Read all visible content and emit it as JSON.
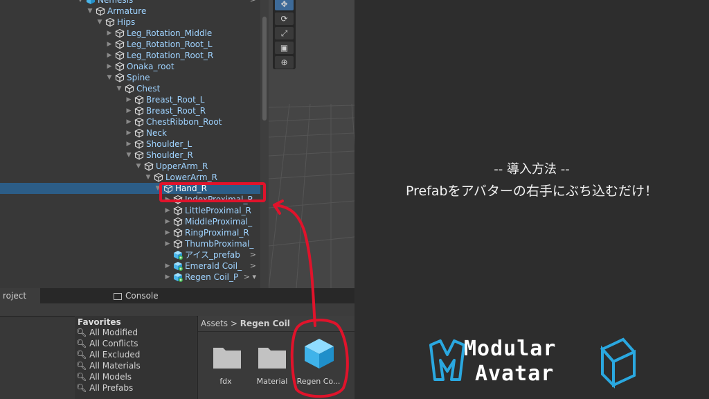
{
  "hierarchy": {
    "rows": [
      {
        "label": "Nemesis",
        "depth": 0,
        "arrow": "▼",
        "icon": "prefab-icon",
        "more": ">"
      },
      {
        "label": "Armature",
        "depth": 1,
        "arrow": "▼",
        "icon": "gameobject-icon"
      },
      {
        "label": "Hips",
        "depth": 2,
        "arrow": "▼",
        "icon": "gameobject-icon"
      },
      {
        "label": "Leg_Rotation_Middle",
        "depth": 3,
        "arrow": "▶",
        "icon": "gameobject-icon"
      },
      {
        "label": "Leg_Rotation_Root_L",
        "depth": 3,
        "arrow": "▶",
        "icon": "gameobject-icon"
      },
      {
        "label": "Leg_Rotation_Root_R",
        "depth": 3,
        "arrow": "▶",
        "icon": "gameobject-icon"
      },
      {
        "label": "Onaka_root",
        "depth": 3,
        "arrow": "▶",
        "icon": "gameobject-icon"
      },
      {
        "label": "Spine",
        "depth": 3,
        "arrow": "▼",
        "icon": "gameobject-icon"
      },
      {
        "label": "Chest",
        "depth": 4,
        "arrow": "▼",
        "icon": "gameobject-icon"
      },
      {
        "label": "Breast_Root_L",
        "depth": 5,
        "arrow": "▶",
        "icon": "gameobject-icon"
      },
      {
        "label": "Breast_Root_R",
        "depth": 5,
        "arrow": "▶",
        "icon": "gameobject-icon"
      },
      {
        "label": "ChestRibbon_Root",
        "depth": 5,
        "arrow": "▶",
        "icon": "gameobject-icon"
      },
      {
        "label": "Neck",
        "depth": 5,
        "arrow": "▶",
        "icon": "gameobject-icon"
      },
      {
        "label": "Shoulder_L",
        "depth": 5,
        "arrow": "▶",
        "icon": "gameobject-icon"
      },
      {
        "label": "Shoulder_R",
        "depth": 5,
        "arrow": "▼",
        "icon": "gameobject-icon"
      },
      {
        "label": "UpperArm_R",
        "depth": 6,
        "arrow": "▼",
        "icon": "gameobject-icon"
      },
      {
        "label": "LowerArm_R",
        "depth": 7,
        "arrow": "▼",
        "icon": "gameobject-icon"
      },
      {
        "label": "Hand_R",
        "depth": 8,
        "arrow": "▼",
        "icon": "gameobject-icon",
        "selected": true
      },
      {
        "label": "IndexProximal_R",
        "depth": 9,
        "arrow": "▶",
        "icon": "gameobject-icon"
      },
      {
        "label": "LittleProximal_R",
        "depth": 9,
        "arrow": "▶",
        "icon": "gameobject-icon"
      },
      {
        "label": "MiddleProximal_",
        "depth": 9,
        "arrow": "▶",
        "icon": "gameobject-icon"
      },
      {
        "label": "RingProximal_R",
        "depth": 9,
        "arrow": "▶",
        "icon": "gameobject-icon"
      },
      {
        "label": "ThumbProximal_",
        "depth": 9,
        "arrow": "▶",
        "icon": "gameobject-icon"
      },
      {
        "label": "アイス_prefab",
        "depth": 9,
        "arrow": "",
        "icon": "prefab-added-icon",
        "more": ">"
      },
      {
        "label": "Emerald Coil_",
        "depth": 9,
        "arrow": "▶",
        "icon": "prefab-added-icon",
        "more": ">"
      },
      {
        "label": "Regen Coil_P",
        "depth": 9,
        "arrow": "▶",
        "icon": "prefab-added-icon",
        "more": "> ▾"
      }
    ]
  },
  "tools": [
    "✥",
    "⟳",
    "⤢",
    "▣",
    "⊕"
  ],
  "tabs": {
    "project": "roject",
    "console": "Console"
  },
  "favorites": {
    "header": "Favorites",
    "items": [
      "All Modified",
      "All Conflicts",
      "All Excluded",
      "All Materials",
      "All Models",
      "All Prefabs"
    ]
  },
  "breadcrumb": {
    "root": "Assets",
    "separator": ">",
    "current": "Regen Coil"
  },
  "assets": [
    {
      "label": "fdx",
      "icon": "folder-icon"
    },
    {
      "label": "Material",
      "icon": "folder-icon"
    },
    {
      "label": "Regen Co...",
      "icon": "prefab-cube-icon"
    }
  ],
  "caption": {
    "heading": "-- 導入方法 --",
    "instruction": "Prefabをアバターの右手にぶち込むだけ！"
  },
  "logo": {
    "line1": "Modular",
    "line2": "Avatar"
  },
  "colors": {
    "selection": "#2c5d87",
    "label": "#9fd3ff",
    "annotation": "#e0132b",
    "logo": "#2aa8e0",
    "prefab": "#5fc8f5"
  }
}
